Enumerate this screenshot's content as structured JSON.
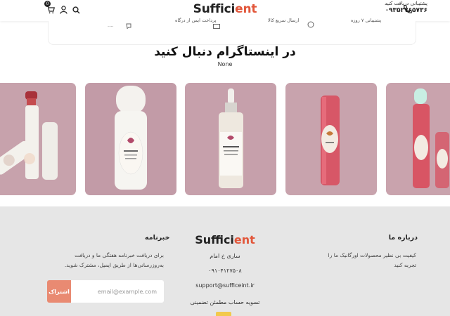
{
  "header": {
    "logo_main": "Suffici",
    "logo_accent": "ent",
    "cart_count": "0",
    "support_label": "پشتیبانی دریافت کنید",
    "support_phone": "۰۹۳۵۲۷۶۵۷۳۶"
  },
  "features": {
    "items": [
      {
        "label": "...."
      },
      {
        "label": "پرداخت ایمن از درگاه"
      },
      {
        "label": "ارسال سریع کالا"
      },
      {
        "label": "پشتیبانی ۷ روزه"
      }
    ]
  },
  "instagram": {
    "title": "در اینستاگرام دنبال کنید",
    "subtitle": "None",
    "tiles": [
      {
        "name": "red lipstick and white tubes"
      },
      {
        "name": "white roll-on bottle"
      },
      {
        "name": "serum dropper bottle"
      },
      {
        "name": "red lip balm tube"
      },
      {
        "name": "mint lip balm"
      }
    ]
  },
  "footer": {
    "about_title": "درباره ما",
    "about_text": "کیفیت بی نظیر محصولات اورگانیک ما را تجربه کنید",
    "logo_main": "Suffici",
    "logo_accent": "ent",
    "address": "ساری خ امام",
    "phone": "۰۹۱۰۴۱۲۷۵۰۸",
    "email": "support@sufficeint.ir",
    "settlement": "تسویه حساب مطمئن تضمینی",
    "newsletter_title": "خبرنامه",
    "newsletter_text": "برای دریافت خبرنامه هفتگی ما و دریافت به‌روزرسانی‌ها از طریق ایمیل، مشترک شوید.",
    "email_placeholder": "email@example.com",
    "subscribe_label": "اشتراک"
  },
  "colors": {
    "accent": "#e2573b",
    "subscribe_button": "#e98a72",
    "footer_bg": "#e6e6e6",
    "tile_bg": "#c9a0ab"
  }
}
